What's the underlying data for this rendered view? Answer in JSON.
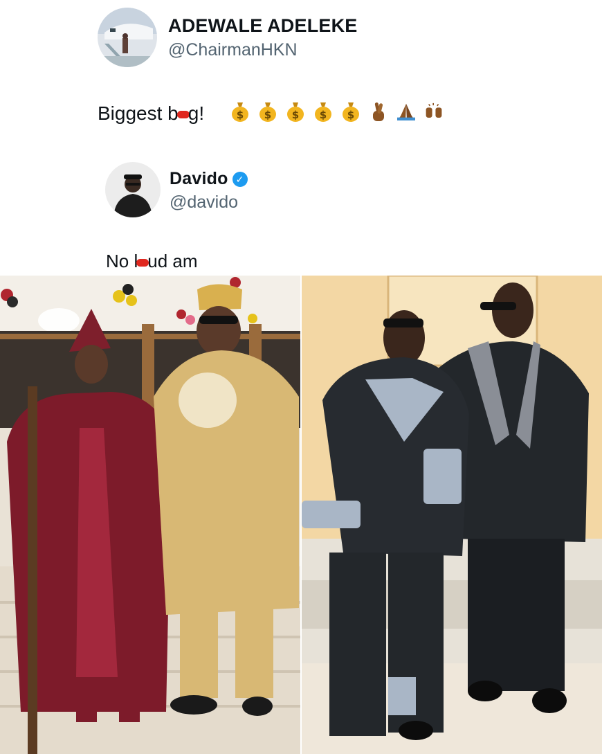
{
  "tweet1": {
    "name": "ADEWALE ADELEKE",
    "handle": "@ChairmanHKN",
    "text_before": "Biggest b",
    "text_after": "g!",
    "emojis": [
      "money-bag",
      "money-bag",
      "money-bag",
      "money-bag",
      "money-bag",
      "crossed-fingers",
      "folded-hands",
      "raising-hands"
    ]
  },
  "tweet2": {
    "name": "Davido",
    "handle": "@davido",
    "text_before": "No l",
    "text_after": "ud am"
  },
  "colors": {
    "handle": "#536471",
    "verified": "#1d9bf0",
    "redaction": "#e0281f"
  }
}
